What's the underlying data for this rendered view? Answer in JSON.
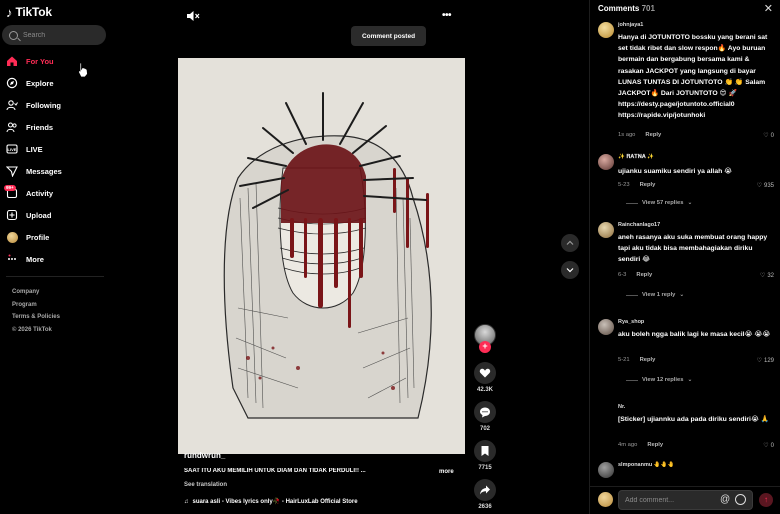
{
  "brand": {
    "name": "TikTok"
  },
  "search": {
    "placeholder": "Search"
  },
  "nav": [
    {
      "label": "For You",
      "icon": "home-icon"
    },
    {
      "label": "Explore",
      "icon": "compass-icon"
    },
    {
      "label": "Following",
      "icon": "following-icon"
    },
    {
      "label": "Friends",
      "icon": "friends-icon"
    },
    {
      "label": "LIVE",
      "icon": "live-icon"
    },
    {
      "label": "Messages",
      "icon": "messages-icon"
    },
    {
      "label": "Activity",
      "icon": "activity-icon",
      "badge": "99+"
    },
    {
      "label": "Upload",
      "icon": "upload-icon"
    },
    {
      "label": "Profile",
      "icon": "profile-avatar"
    },
    {
      "label": "More",
      "icon": "more-icon"
    }
  ],
  "footer": [
    "Company",
    "Program",
    "Terms & Policies",
    "© 2026 TikTok"
  ],
  "video": {
    "toast": "Comment posted",
    "author": "rundwrun_",
    "caption": "SAAT ITU AKU MEMILIH UNTUK DIAM DAN TIDAK PERDULI!! ...",
    "more": "more",
    "translation": "See translation",
    "music": "suara asli - Vibes lyrics only🥀 - HairLuxLab Official Store"
  },
  "actions": {
    "likes": "42.3K",
    "comments": "702",
    "saves": "7715",
    "shares": "2636"
  },
  "comments_panel": {
    "title": "Comments",
    "count": "701",
    "input_placeholder": "Add comment...",
    "items": [
      {
        "user": "johnjaya1",
        "text": "Hanya di JOTUNTOTO bossku yang berani sat set tidak ribet dan slow respon🔥 Ayo buruan bermain dan bergabung bersama kami & rasakan JACKPOT yang langsung di bayar LUNAS TUNTAS DI JOTUNTOTO 👏 👏 Salam JACKPOT🔥 Dari JOTUNTOTO 😍 🚀 https://desty.page/jotuntoto.official0 https://rapide.vip/jotunhoki",
        "time": "1s ago",
        "reply": "Reply",
        "likes": "0"
      },
      {
        "user": "✨ 𝐑𝐀𝐓𝐍𝐀 ✨",
        "text": "ujianku suamiku sendiri ya allah 😭",
        "time": "5-23",
        "reply": "Reply",
        "likes": "935",
        "replies": "View 57 replies"
      },
      {
        "user": "Rainchanlago17",
        "text": "aneh rasanya aku suka membuat orang happy tapi aku tidak bisa membahagiakan diriku sendiri 😂",
        "time": "6-3",
        "reply": "Reply",
        "likes": "32",
        "replies": "View 1 reply"
      },
      {
        "user": "Rya_shop",
        "text": "aku boleh ngga balik lagi ke masa kecil😭 😭😭",
        "time": "5-21",
        "reply": "Reply",
        "likes": "129",
        "replies": "View 12 replies"
      },
      {
        "user": "Nr.",
        "text": "[Sticker] ujiannku ada pada diriku sendiri😭 🙏",
        "time": "4m ago",
        "reply": "Reply",
        "likes": "0"
      },
      {
        "user": "slmponanmu 🤚🤚🤚",
        "text": "",
        "time": "",
        "reply": "",
        "likes": ""
      }
    ]
  }
}
